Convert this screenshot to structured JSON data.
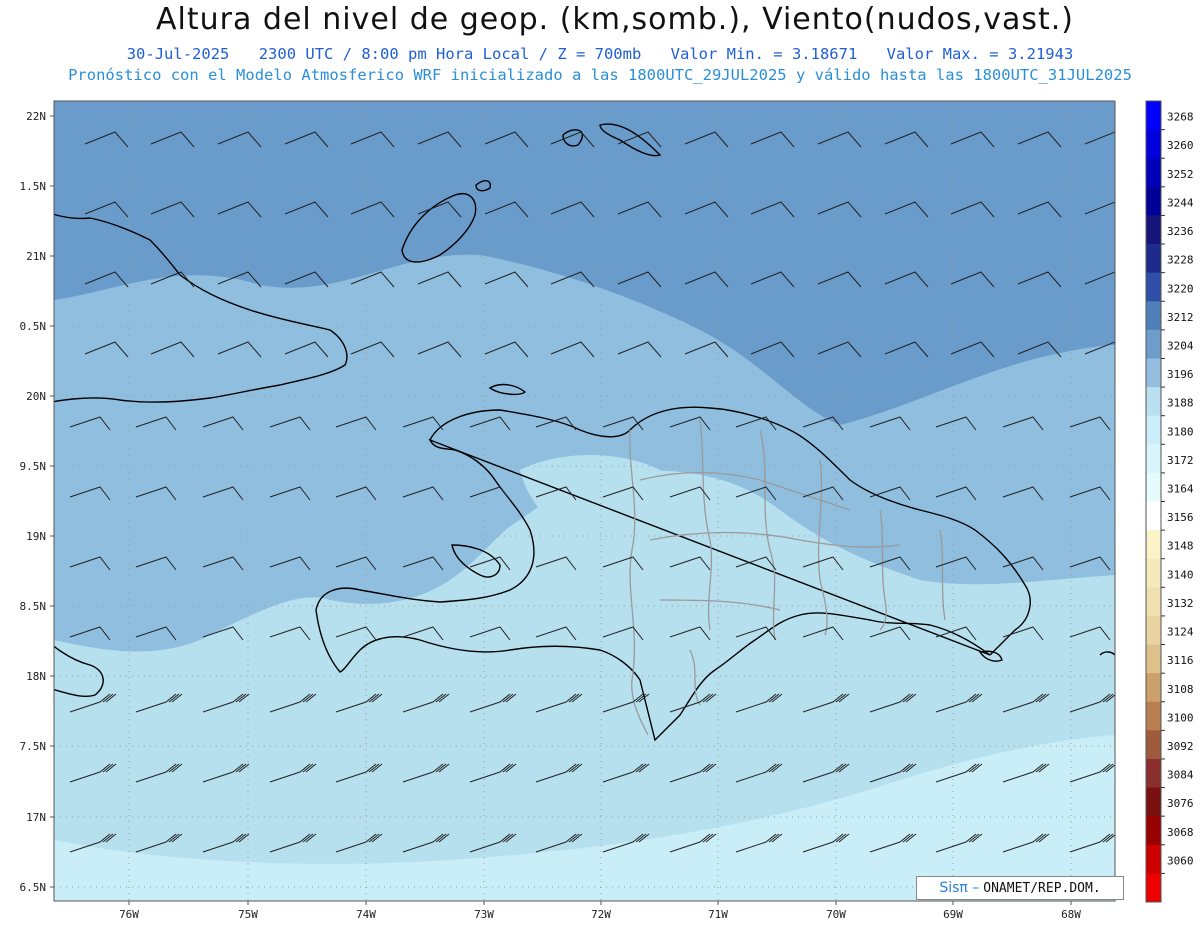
{
  "header": {
    "title": "Altura del nivel de geop. (km,somb.), Viento(nudos,vast.)",
    "date": "30-Jul-2025",
    "time": "2300 UTC / 8:00 pm Hora Local / Z = 700mb",
    "min": "Valor Min. = 3.18671",
    "max": "Valor Max. = 3.21943",
    "model_line": "Pronóstico con el Modelo Atmosferico WRF inicializado a las 1800UTC_29JUL2025 y válido hasta las  1800UTC_31JUL2025"
  },
  "axes": {
    "lat_labels": [
      "22N",
      "1.5N",
      "21N",
      "0.5N",
      "20N",
      "9.5N",
      "19N",
      "8.5N",
      "18N",
      "7.5N",
      "17N",
      "6.5N"
    ],
    "lon_labels": [
      "76W",
      "75W",
      "74W",
      "73W",
      "72W",
      "71W",
      "70W",
      "69W",
      "68W"
    ]
  },
  "colorbar": {
    "levels": [
      "3268",
      "3260",
      "3252",
      "3244",
      "3236",
      "3228",
      "3220",
      "3212",
      "3204",
      "3196",
      "3188",
      "3180",
      "3172",
      "3164",
      "3156",
      "3148",
      "3140",
      "3132",
      "3124",
      "3116",
      "3108",
      "3100",
      "3092",
      "3084",
      "3076",
      "3068",
      "3060"
    ],
    "colors": [
      "#0000ff",
      "#0000dd",
      "#0000bb",
      "#000099",
      "#15157a",
      "#1e2a8c",
      "#2e4ea8",
      "#4f7fb8",
      "#6f9dc9",
      "#94bedf",
      "#b9dff0",
      "#cceefa",
      "#d9f5fb",
      "#e6fbfd",
      "#ffffff",
      "#fbf3c8",
      "#f5eabc",
      "#efe0b0",
      "#e8d3a1",
      "#ddc08a",
      "#cca06a",
      "#b88050",
      "#a05a3c",
      "#8a2e2e",
      "#7a1010",
      "#990000",
      "#cc0000",
      "#ee0000"
    ]
  },
  "logo": {
    "sis": "Sisπ –",
    "org": "ONAMET/REP.DOM."
  }
}
